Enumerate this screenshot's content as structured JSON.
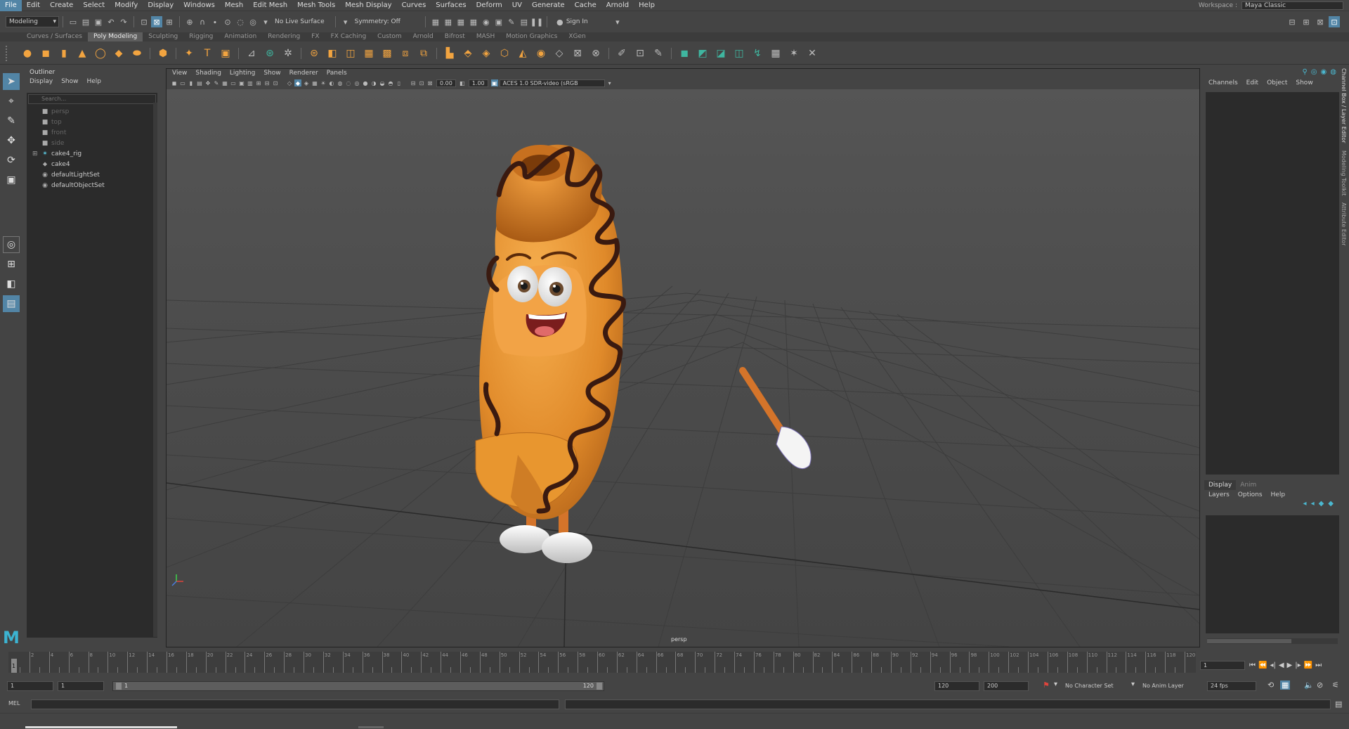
{
  "menubar": {
    "items": [
      "File",
      "Edit",
      "Create",
      "Select",
      "Modify",
      "Display",
      "Windows",
      "Mesh",
      "Edit Mesh",
      "Mesh Tools",
      "Mesh Display",
      "Curves",
      "Surfaces",
      "Deform",
      "UV",
      "Generate",
      "Cache",
      "Arnold",
      "Help"
    ],
    "workspace_label": "Workspace :",
    "workspace_value": "Maya Classic"
  },
  "statusline": {
    "mode": "Modeling",
    "live_surface": "No Live Surface",
    "symmetry": "Symmetry: Off",
    "sign_in": "Sign In"
  },
  "shelf": {
    "tabs": [
      "Curves / Surfaces",
      "Poly Modeling",
      "Sculpting",
      "Rigging",
      "Animation",
      "Rendering",
      "FX",
      "FX Caching",
      "Custom",
      "Arnold",
      "Bifrost",
      "MASH",
      "Motion Graphics",
      "XGen"
    ],
    "active_tab": "Poly Modeling"
  },
  "outliner": {
    "title": "Outliner",
    "menu": [
      "Display",
      "Show",
      "Help"
    ],
    "search_placeholder": "Search...",
    "items": [
      {
        "label": "persp",
        "icon": "camera-icon",
        "dim": true,
        "expand": ""
      },
      {
        "label": "top",
        "icon": "camera-icon",
        "dim": true,
        "expand": ""
      },
      {
        "label": "front",
        "icon": "camera-icon",
        "dim": true,
        "expand": ""
      },
      {
        "label": "side",
        "icon": "camera-icon",
        "dim": true,
        "expand": ""
      },
      {
        "label": "cake4_rig",
        "icon": "joint-icon",
        "dim": false,
        "expand": "⊞"
      },
      {
        "label": "cake4",
        "icon": "transform-icon",
        "dim": false,
        "expand": ""
      },
      {
        "label": "defaultLightSet",
        "icon": "set-icon",
        "dim": false,
        "expand": ""
      },
      {
        "label": "defaultObjectSet",
        "icon": "set-icon",
        "dim": false,
        "expand": ""
      }
    ]
  },
  "viewport": {
    "menu": [
      "View",
      "Shading",
      "Lighting",
      "Show",
      "Renderer",
      "Panels"
    ],
    "exposure": "0.00",
    "gamma": "1.00",
    "color_space": "ACES 1.0 SDR-video (sRGB",
    "camera_label": "persp"
  },
  "channelbox": {
    "menu": [
      "Channels",
      "Edit",
      "Object",
      "Show"
    ]
  },
  "layer_editor": {
    "tabs": [
      "Display",
      "Anim"
    ],
    "active_tab": "Display",
    "menu": [
      "Layers",
      "Options",
      "Help"
    ]
  },
  "side_tabs": [
    "Channel Box / Layer Editor",
    "Modeling Toolkit",
    "Attribute Editor"
  ],
  "timeline": {
    "ticks": [
      "2",
      "4",
      "6",
      "8",
      "10",
      "12",
      "14",
      "16",
      "18",
      "20",
      "22",
      "24",
      "26",
      "28",
      "30",
      "32",
      "34",
      "36",
      "38",
      "40",
      "42",
      "44",
      "46",
      "48",
      "50",
      "52",
      "54",
      "56",
      "58",
      "60",
      "62",
      "64",
      "66",
      "68",
      "70",
      "72",
      "74",
      "76",
      "78",
      "80",
      "82",
      "84",
      "86",
      "88",
      "90",
      "92",
      "94",
      "96",
      "98",
      "100",
      "102",
      "104",
      "106",
      "108",
      "110",
      "112",
      "114",
      "116",
      "118",
      "120"
    ],
    "current_frame_marker": "1",
    "current_frame": "1"
  },
  "range": {
    "start": "1",
    "playback_start": "1",
    "bar_start": "1",
    "bar_end": "120",
    "playback_end": "120",
    "end": "200",
    "character_set": "No Character Set",
    "anim_layer": "No Anim Layer",
    "fps": "24 fps"
  },
  "cmdline": {
    "label": "MEL"
  },
  "colors": {
    "accent": "#5285a6",
    "shelf_orange": "#f2a440",
    "teal": "#3fb6a0",
    "maya_blue": "#3cb4d2"
  }
}
